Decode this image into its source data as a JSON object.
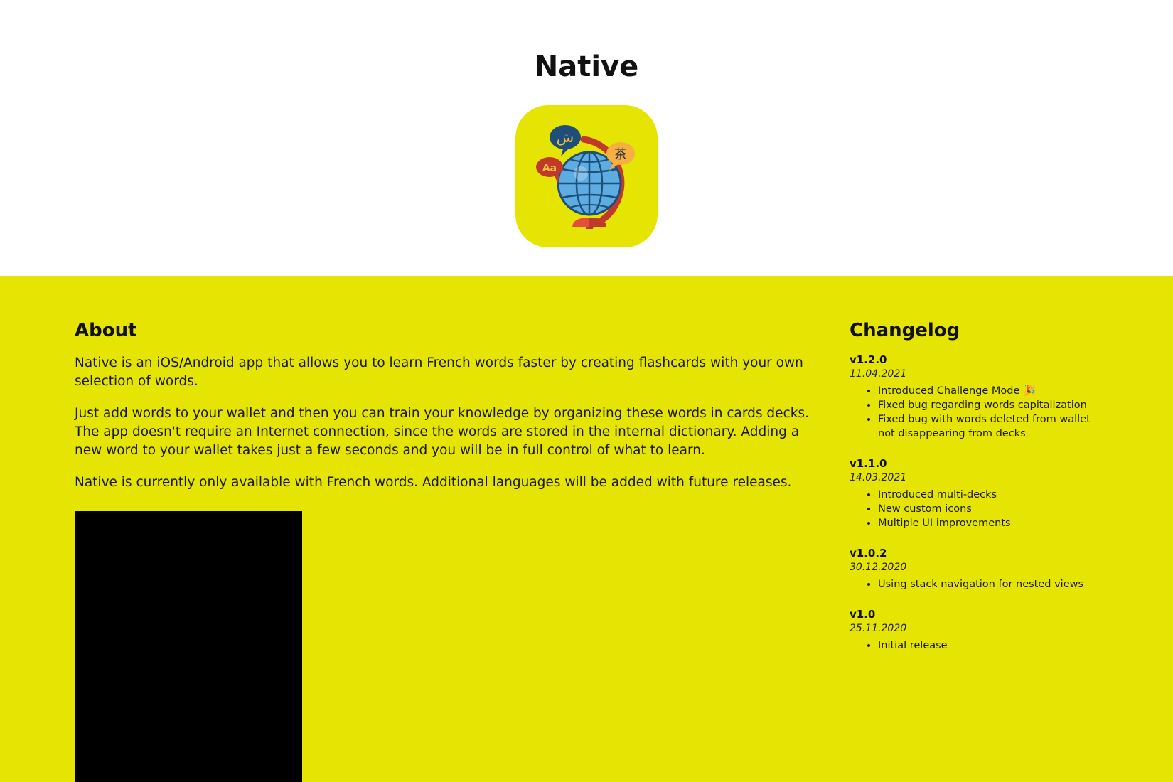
{
  "header": {
    "title": "Native",
    "icon": "globe-languages-icon",
    "icon_bg": "#e6e402"
  },
  "about": {
    "heading": "About",
    "paragraphs": [
      "Native is an iOS/Android app that allows you to learn French words faster by creating flashcards with your own selection of words.",
      "Just add words to your wallet and then you can train your knowledge by organizing these words in cards decks. The app doesn't require an Internet connection, since the words are stored in the internal dictionary. Adding a new word to your wallet takes just a few seconds and you will be in full control of what to learn.",
      "Native is currently only available with French words. Additional languages will be added with future releases."
    ]
  },
  "changelog": {
    "heading": "Changelog",
    "releases": [
      {
        "version": "v1.2.0",
        "date": "11.04.2021",
        "items": [
          "Introduced Challenge Mode 🎉",
          "Fixed bug regarding words capitalization",
          "Fixed bug with words deleted from wallet not disappearing from decks"
        ]
      },
      {
        "version": "v1.1.0",
        "date": "14.03.2021",
        "items": [
          "Introduced multi-decks",
          "New custom icons",
          "Multiple UI improvements"
        ]
      },
      {
        "version": "v1.0.2",
        "date": "30.12.2020",
        "items": [
          "Using stack navigation for nested views"
        ]
      },
      {
        "version": "v1.0",
        "date": "25.11.2020",
        "items": [
          "Initial release"
        ]
      }
    ]
  },
  "colors": {
    "accent": "#e6e402",
    "background": "#ffffff",
    "text": "#111111",
    "media": "#000000"
  }
}
